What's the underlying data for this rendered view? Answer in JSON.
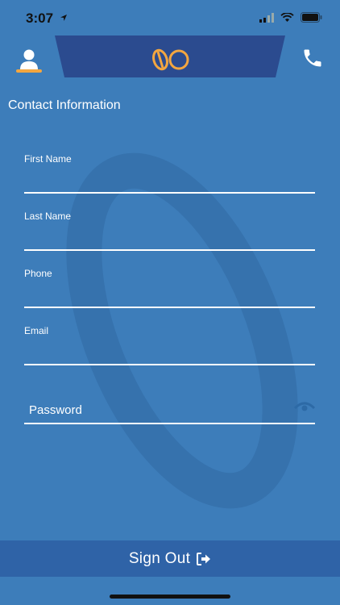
{
  "status": {
    "time": "3:07"
  },
  "section_title": "Contact Information",
  "fields": {
    "first_name": {
      "label": "First Name",
      "value": ""
    },
    "last_name": {
      "label": "Last Name",
      "value": ""
    },
    "phone": {
      "label": "Phone",
      "value": ""
    },
    "email": {
      "label": "Email",
      "value": ""
    },
    "password": {
      "placeholder": "Password"
    }
  },
  "footer": {
    "signout_label": "Sign Out"
  },
  "colors": {
    "background": "#3d7dba",
    "header_center": "#2b4b8f",
    "accent": "#f3a640",
    "footer_bar": "#2f63a7"
  },
  "icons": {
    "profile": "person-icon",
    "phone": "phone-icon",
    "logo": "brand-logo",
    "eye": "eye-icon",
    "signout": "sign-out-icon"
  }
}
